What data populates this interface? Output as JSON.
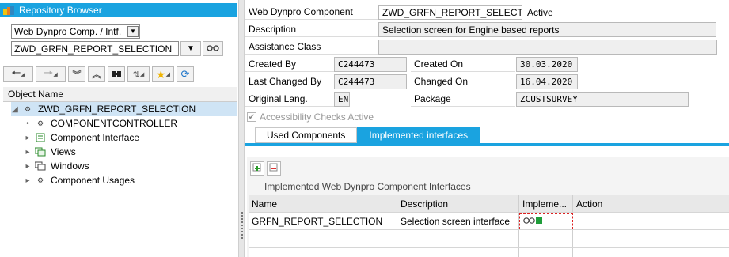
{
  "left": {
    "header_title": "Repository Browser",
    "object_type": "Web Dynpro Comp. / Intf.",
    "object_name": "ZWD_GRFN_REPORT_SELECTION",
    "tree_header": "Object Name",
    "tree": {
      "root": "ZWD_GRFN_REPORT_SELECTION",
      "items": [
        "COMPONENTCONTROLLER",
        "Component Interface",
        "Views",
        "Windows",
        "Component Usages"
      ]
    }
  },
  "form": {
    "component_label": "Web Dynpro Component",
    "component_value": "ZWD_GRFN_REPORT_SELECTIO",
    "component_status": "Active",
    "description_label": "Description",
    "description_value": "Selection screen for Engine based reports",
    "assistance_label": "Assistance Class",
    "assistance_value": "",
    "created_by_label": "Created By",
    "created_by_value": "C244473",
    "created_on_label": "Created On",
    "created_on_value": "30.03.2020",
    "changed_by_label": "Last Changed By",
    "changed_by_value": "C244473",
    "changed_on_label": "Changed On",
    "changed_on_value": "16.04.2020",
    "orig_lang_label": "Original Lang.",
    "orig_lang_value": "EN",
    "package_label": "Package",
    "package_value": "ZCUSTSURVEY",
    "accessibility_label": "Accessibility Checks Active"
  },
  "tabs": [
    {
      "label": "Used Components",
      "active": false
    },
    {
      "label": "Implemented interfaces",
      "active": true
    }
  ],
  "table": {
    "title": "Implemented Web Dynpro Component Interfaces",
    "columns": [
      "Name",
      "Description",
      "Impleme...",
      "Action"
    ],
    "rows": [
      {
        "name": "GRFN_REPORT_SELECTION",
        "description": "Selection screen interface",
        "status_icon": "implemented-status-icon",
        "action": ""
      }
    ]
  },
  "colors": {
    "accent": "#1aa3e0",
    "selection": "#cfe4f5",
    "status_green": "#1f9d3a"
  }
}
